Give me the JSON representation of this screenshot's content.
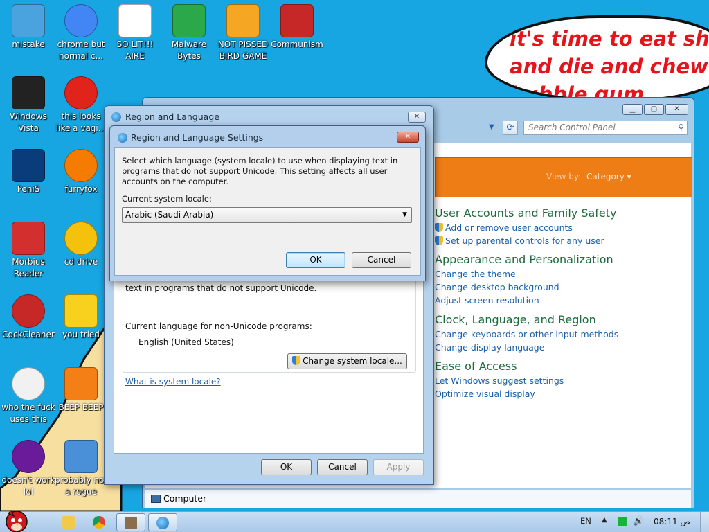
{
  "desktop": {
    "meme_text": "it's time to eat shit\nand die and chew\nbubble gum",
    "icons": [
      {
        "label": "mistake",
        "icon": "computer-icon"
      },
      {
        "label": "chrome but normal c...",
        "icon": "chrome-icon"
      },
      {
        "label": "SO LIT!!! AIRE",
        "icon": "solitaire-icon"
      },
      {
        "label": "Malware Bytes",
        "icon": "shield-icon"
      },
      {
        "label": "NOT PISSED BIRD GAME",
        "icon": "bad-piggies-icon"
      },
      {
        "label": "Communism",
        "icon": "emblem-icon"
      },
      {
        "label": "Windows Vista",
        "icon": "trash-bin-icon"
      },
      {
        "label": "this looks like a vagi...",
        "icon": "opera-icon"
      },
      {
        "label": "PeniS",
        "icon": "photoshop-icon"
      },
      {
        "label": "furryfox",
        "icon": "firefox-icon"
      },
      {
        "label": "Morbius Reader",
        "icon": "pdf-reader-icon"
      },
      {
        "label": "cd drive",
        "icon": "cd-icon"
      },
      {
        "label": "CockCleaner",
        "icon": "ccleaner-icon"
      },
      {
        "label": "you tried",
        "icon": "star-icon"
      },
      {
        "label": "who the fuck uses this",
        "icon": "winamp-icon"
      },
      {
        "label": "BEEP BEEP",
        "icon": "vlc-icon"
      },
      {
        "label": "doesn't work lol",
        "icon": "yahoo-messenger-icon"
      },
      {
        "label": "probably not a rogue",
        "icon": "system-tool-icon"
      }
    ]
  },
  "control_panel": {
    "search_placeholder": "Search Control Panel",
    "view_by_label": "View by:",
    "view_by_value": "Category",
    "categories": [
      {
        "title": "User Accounts and Family Safety",
        "links": [
          "Add or remove user accounts",
          "Set up parental controls for any user"
        ]
      },
      {
        "title": "Appearance and Personalization",
        "links": [
          "Change the theme",
          "Change desktop background",
          "Adjust screen resolution"
        ]
      },
      {
        "title": "Clock, Language, and Region",
        "links": [
          "Change keyboards or other input methods",
          "Change display language"
        ]
      },
      {
        "title": "Ease of Access",
        "links": [
          "Let Windows suggest settings",
          "Optimize visual display"
        ]
      }
    ],
    "status_text": "Computer"
  },
  "region_dialog": {
    "title": "Region and Language",
    "partial_text": "text in programs that do not support Unicode.",
    "current_language_label": "Current language for non-Unicode programs:",
    "current_language_value": "English (United States)",
    "change_locale_button": "Change system locale...",
    "what_is_link": "What is system locale?",
    "ok": "OK",
    "cancel": "Cancel",
    "apply": "Apply"
  },
  "settings_dialog": {
    "title": "Region and Language Settings",
    "description": "Select which language (system locale) to use when displaying text in programs that do not support Unicode. This setting affects all user accounts on the computer.",
    "locale_label": "Current system locale:",
    "locale_value": "Arabic (Saudi Arabia)",
    "ok": "OK",
    "cancel": "Cancel"
  },
  "taskbar": {
    "language": "EN",
    "clock": "08:11 ص"
  },
  "colors": {
    "desktop": "#17a6e2",
    "wedge": "#f7dfa0",
    "meme_text": "#e5141a",
    "cp_band": "#ef7d16",
    "category_title": "#1e6a3c",
    "link": "#1a5fa8"
  }
}
